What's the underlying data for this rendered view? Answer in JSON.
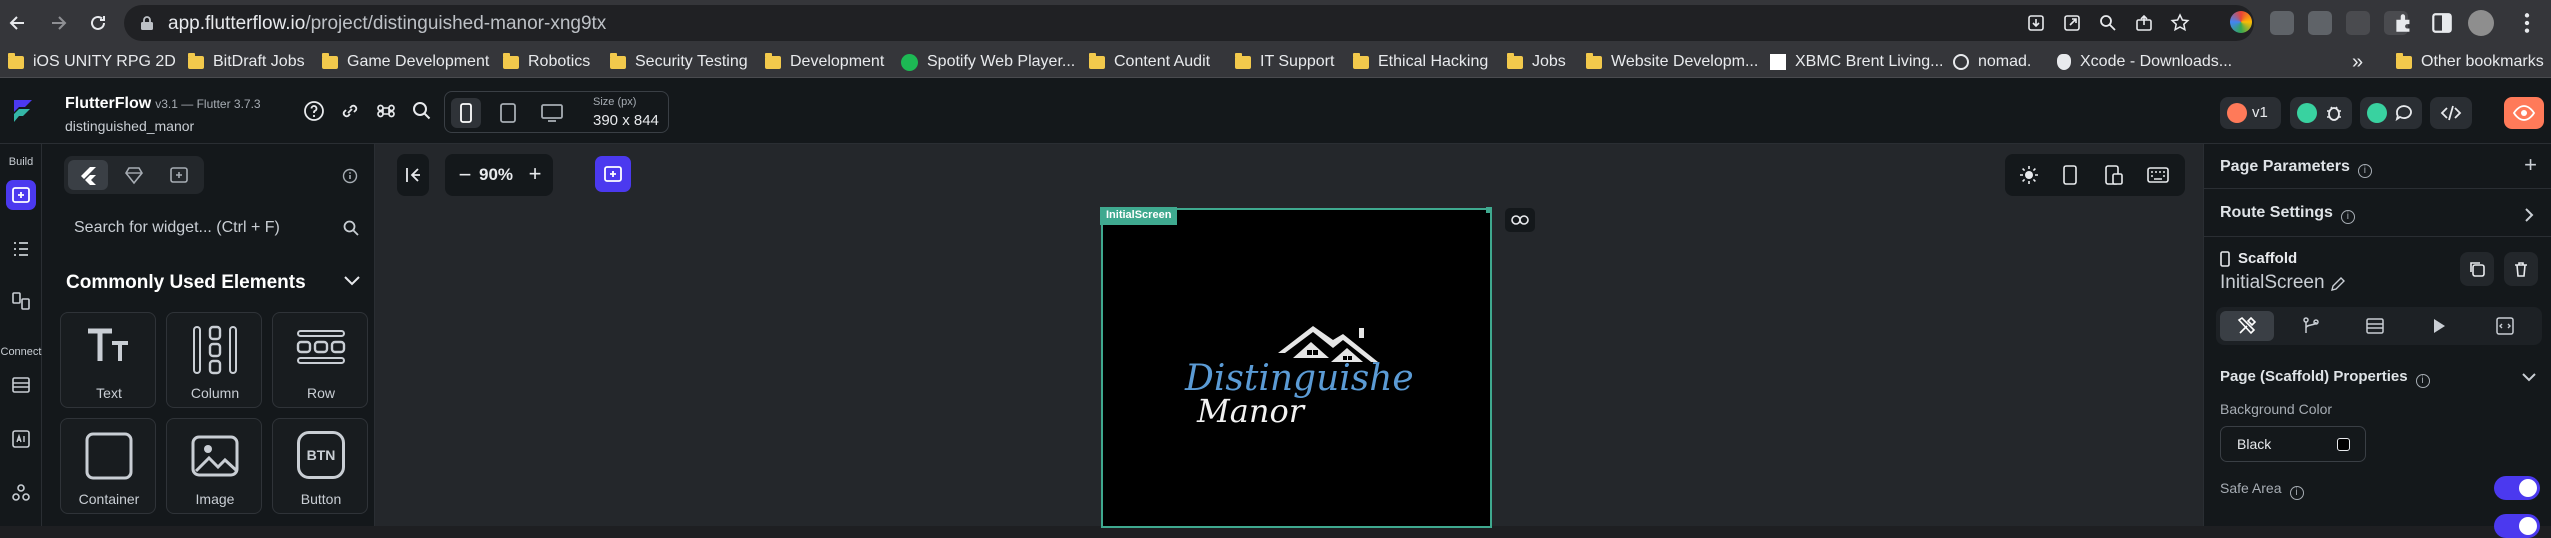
{
  "browser": {
    "url_host": "app.flutterflow.io",
    "url_path": "/project/distinguished-manor-xng9tx",
    "bookmarks": [
      {
        "label": "iOS UNITY RPG 2D",
        "icon": "folder-icon"
      },
      {
        "label": "BitDraft Jobs",
        "icon": "folder-icon"
      },
      {
        "label": "Game Development",
        "icon": "folder-icon"
      },
      {
        "label": "Robotics",
        "icon": "folder-icon"
      },
      {
        "label": "Security Testing",
        "icon": "folder-icon"
      },
      {
        "label": "Development",
        "icon": "folder-icon"
      },
      {
        "label": "Spotify Web Player...",
        "icon": "spotify-icon"
      },
      {
        "label": "Content Audit",
        "icon": "folder-icon"
      },
      {
        "label": "IT Support",
        "icon": "folder-icon"
      },
      {
        "label": "Ethical Hacking",
        "icon": "folder-icon"
      },
      {
        "label": "Jobs",
        "icon": "folder-icon"
      },
      {
        "label": "Website Developm...",
        "icon": "folder-icon"
      },
      {
        "label": "XBMC Brent Living...",
        "icon": "xbmc-icon"
      },
      {
        "label": "nomad.",
        "icon": "globe-icon"
      },
      {
        "label": "Xcode - Downloads...",
        "icon": "apple-icon"
      }
    ],
    "overflow": "»",
    "other_bookmarks": "Other bookmarks"
  },
  "app": {
    "name": "FlutterFlow",
    "version": "v3.1 — Flutter 3.7.3",
    "project": "distinguished_manor",
    "size_label": "Size (px)",
    "size_value": "390 x 844",
    "version_badge": "v1"
  },
  "rail": {
    "build_label": "Build",
    "connect_label": "Connect"
  },
  "widget_panel": {
    "search_placeholder": "Search for widget... (Ctrl + F)",
    "section_title": "Commonly Used Elements",
    "tiles": [
      {
        "label": "Text",
        "icon": "text-icon"
      },
      {
        "label": "Column",
        "icon": "column-icon"
      },
      {
        "label": "Row",
        "icon": "row-icon"
      },
      {
        "label": "Container",
        "icon": "container-icon"
      },
      {
        "label": "Image",
        "icon": "image-icon"
      },
      {
        "label": "Button",
        "icon": "button-icon",
        "glyph": "BTN"
      }
    ]
  },
  "canvas": {
    "zoom": "90%",
    "screen_name": "InitialScreen",
    "logo_line1": "Distinguished",
    "logo_line2": "Manor"
  },
  "properties": {
    "page_parameters": "Page Parameters",
    "route_settings": "Route Settings",
    "widget_type": "Scaffold",
    "page_name": "InitialScreen",
    "section": "Page (Scaffold) Properties",
    "bg_color_label": "Background Color",
    "bg_color_value": "Black",
    "safe_area_label": "Safe Area"
  },
  "colors": {
    "accent": "#4b39ef",
    "screen_outline": "#3fa98f",
    "logo_blue": "#5b9bd5",
    "eye_button": "#ff7a59"
  }
}
